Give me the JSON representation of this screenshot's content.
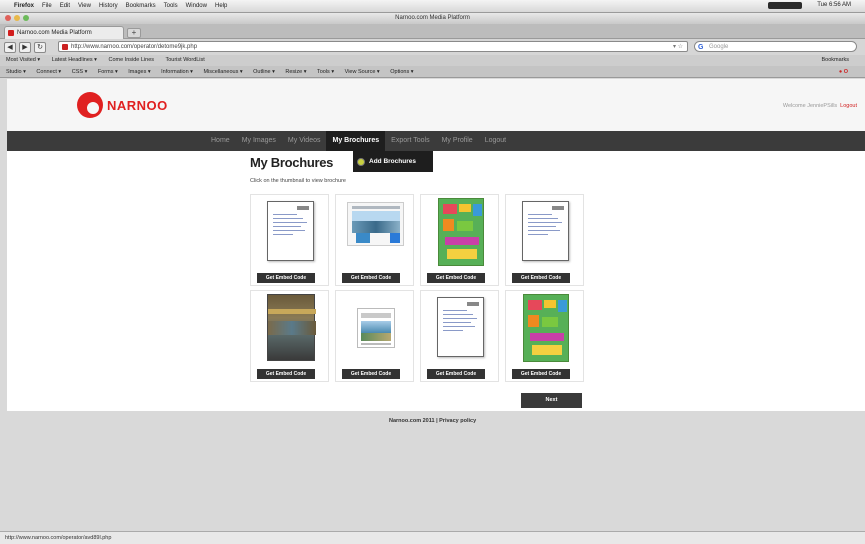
{
  "mac_menubar": {
    "items": [
      "Firefox",
      "File",
      "Edit",
      "View",
      "History",
      "Bookmarks",
      "Tools",
      "Window",
      "Help"
    ],
    "clock": "Tue 6:56 AM"
  },
  "window": {
    "title": "Narnoo.com Media Platform"
  },
  "tab": {
    "label": "Narnoo.com Media Platform",
    "new_tab": "+"
  },
  "nav": {
    "back": "◀",
    "forward": "▶",
    "reload": "↻",
    "url": "http://www.narnoo.com/operator/detome9jk.php",
    "search_placeholder": "Google",
    "search_engine": "G"
  },
  "bookmarks": {
    "items": [
      "Most Visited ▾",
      "Latest Headlines ▾",
      "Come Inside Lines",
      "Tourist WordList"
    ],
    "right": "Bookmarks"
  },
  "toolbar2": {
    "items": [
      "Studio ▾",
      "Connect ▾",
      "CSS ▾",
      "Forms ▾",
      "Images ▾",
      "Information ▾",
      "Miscellaneous ▾",
      "Outline ▾",
      "Resize ▾",
      "Tools ▾",
      "View Source ▾",
      "Options ▾"
    ],
    "right": "● O"
  },
  "site": {
    "logo_text": "NARNOO",
    "welcome_text": "Welcome JenniePSills",
    "logout_link": "Logout"
  },
  "site_nav": {
    "items": [
      {
        "label": "Home",
        "active": false
      },
      {
        "label": "My Images",
        "active": false
      },
      {
        "label": "My Videos",
        "active": false
      },
      {
        "label": "My Brochures",
        "active": true
      },
      {
        "label": "Export Tools",
        "active": false
      },
      {
        "label": "My Profile",
        "active": false
      },
      {
        "label": "Logout",
        "active": false
      }
    ],
    "submenu_label": "Add Brochures"
  },
  "main": {
    "title": "My Brochures",
    "intro": "Click on the thumbnail to view brochure",
    "embed_label": "Get Embed Code",
    "next_label": "Next"
  },
  "footer": {
    "text": "Narnoo.com 2011 | Privacy policy"
  },
  "status_bar": {
    "text": "http://www.narnoo.com/operator/avd89l.php"
  },
  "colors": {
    "brand_red": "#e02020",
    "nav_bg": "#3b3b3b",
    "active_tab_bg": "#1e1e1e",
    "button_bg": "#333333"
  }
}
